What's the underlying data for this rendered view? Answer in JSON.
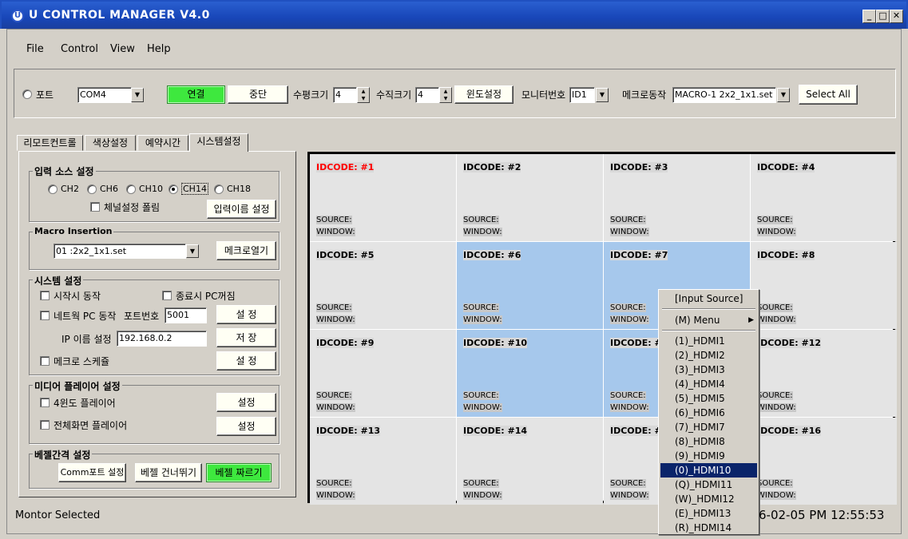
{
  "window": {
    "title": "U CONTROL MANAGER V4.0",
    "logo": "U",
    "min": "_",
    "max": "□",
    "close": "✕"
  },
  "menu": [
    "File",
    "Control",
    "View",
    "Help"
  ],
  "toolbar": {
    "port_label": "포트",
    "port_value": "COM4",
    "connect": "연결",
    "stop": "중단",
    "hsize_label": "수평크기",
    "hsize_value": "4",
    "vsize_label": "수직크기",
    "vsize_value": "4",
    "window_setup": "윈도설정",
    "monitor_label": "모니터번호",
    "monitor_value": "ID1",
    "macro_label": "메크로동작",
    "macro_value": "MACRO-1  2x2_1x1.set",
    "select_all": "Select All"
  },
  "tabs": [
    "리모트컨트롤",
    "색상설정",
    "예약시간",
    "시스템설정"
  ],
  "input_source": {
    "title": "입력 소스 설정",
    "channels": [
      "CH2",
      "CH6",
      "CH10",
      "CH14",
      "CH18"
    ],
    "selected": "CH14",
    "poll_label": "체널설정 폴림",
    "rename_button": "입력이름 설정"
  },
  "macro_insertion": {
    "title": "Macro Insertion",
    "value": "01 :2x2_1x1.set",
    "open_button": "메크로열기"
  },
  "system": {
    "title": "시스템 설정",
    "startup_label": "시작시 동작",
    "shutdown_label": "종료시 PC꺼짐",
    "network_label": "네트웍 PC 동작",
    "port_label": "포트번호",
    "port_value": "5001",
    "set_button": "설 정",
    "ip_label": "IP 이름 설정",
    "ip_value": "192.168.0.2",
    "save_button": "저 장",
    "schedule_label": "메크로 스케쥴",
    "schedule_button": "설 정"
  },
  "media": {
    "title": "미디어 플레이어 설정",
    "quad_label": "4윈도 플레이어",
    "quad_button": "설정",
    "full_label": "전체화면 플레이어",
    "full_button": "설정"
  },
  "bezel": {
    "title": "베젤간격 설정",
    "comm_button": "Comm포트 설정",
    "skip_button": "베젤 건너뛰기",
    "cut_button": "베젤 짜르기"
  },
  "grid": {
    "source_label": "SOURCE:",
    "window_label": "WINDOW:",
    "cells": [
      {
        "id": "IDCODE: #1",
        "selected": false,
        "highlight": true
      },
      {
        "id": "IDCODE: #2",
        "selected": false
      },
      {
        "id": "IDCODE: #3",
        "selected": false
      },
      {
        "id": "IDCODE: #4",
        "selected": false
      },
      {
        "id": "IDCODE: #5",
        "selected": false
      },
      {
        "id": "IDCODE: #6",
        "selected": true
      },
      {
        "id": "IDCODE: #7",
        "selected": true
      },
      {
        "id": "IDCODE: #8",
        "selected": false
      },
      {
        "id": "IDCODE: #9",
        "selected": false
      },
      {
        "id": "IDCODE: #10",
        "selected": true
      },
      {
        "id": "IDCODE: #11",
        "selected": true
      },
      {
        "id": "IDCODE: #12",
        "selected": false
      },
      {
        "id": "IDCODE: #13",
        "selected": false
      },
      {
        "id": "IDCODE: #14",
        "selected": false
      },
      {
        "id": "IDCODE: #15",
        "selected": false
      },
      {
        "id": "IDCODE: #16",
        "selected": false
      }
    ]
  },
  "context_menu": {
    "header": "[Input Source]",
    "menu_item": "(M) Menu",
    "items": [
      "(1)_HDMI1",
      "(2)_HDMI2",
      "(3)_HDMI3",
      "(4)_HDMI4",
      "(5)_HDMI5",
      "(6)_HDMI6",
      "(7)_HDMI7",
      "(8)_HDMI8",
      "(9)_HDMI9",
      "(0)_HDMI10",
      "(Q)_HDMI11",
      "(W)_HDMI12",
      "(E)_HDMI13",
      "(R)_HDMI14"
    ],
    "highlighted": "(0)_HDMI10"
  },
  "status": {
    "left": "Montor  Selected",
    "right": "6-02-05 PM 12:55:53"
  }
}
